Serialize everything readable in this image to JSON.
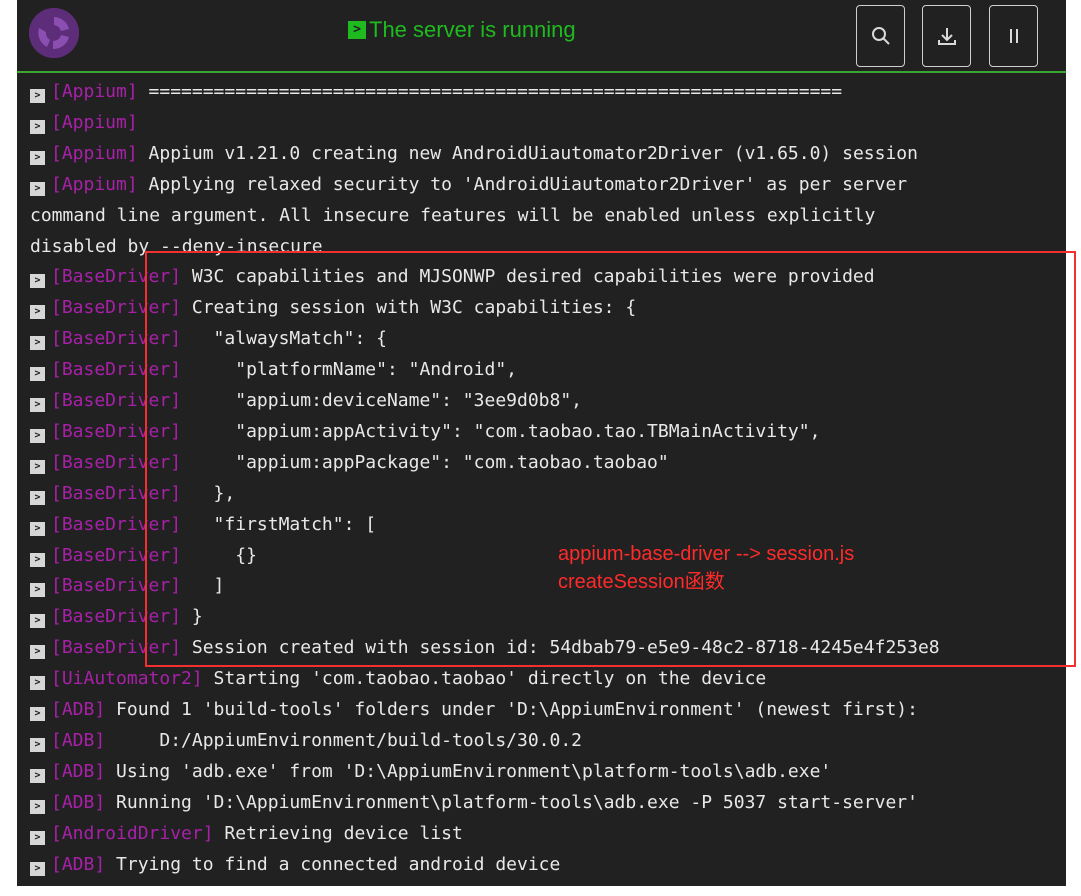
{
  "header": {
    "status_text": "The server is running",
    "buttons": [
      {
        "name": "search-button",
        "icon": "search-icon"
      },
      {
        "name": "download-logs-button",
        "icon": "download-icon"
      },
      {
        "name": "pause-button",
        "icon": "pause-icon"
      }
    ]
  },
  "log": [
    {
      "tag": "[Appium]",
      "msg": " ================================================================"
    },
    {
      "tag": "[Appium]",
      "msg": ""
    },
    {
      "tag": "[Appium]",
      "msg": " Appium v1.21.0 creating new AndroidUiautomator2Driver (v1.65.0) session"
    },
    {
      "tag": "[Appium]",
      "msg": " Applying relaxed security to 'AndroidUiautomator2Driver' as per server"
    },
    {
      "tag": "",
      "msg": "command line argument. All insecure features will be enabled unless explicitly"
    },
    {
      "tag": "",
      "msg": "disabled by --deny-insecure"
    },
    {
      "tag": "[BaseDriver]",
      "msg": " W3C capabilities and MJSONWP desired capabilities were provided"
    },
    {
      "tag": "[BaseDriver]",
      "msg": " Creating session with W3C capabilities: {"
    },
    {
      "tag": "[BaseDriver]",
      "msg": "   \"alwaysMatch\": {"
    },
    {
      "tag": "[BaseDriver]",
      "msg": "     \"platformName\": \"Android\","
    },
    {
      "tag": "[BaseDriver]",
      "msg": "     \"appium:deviceName\": \"3ee9d0b8\","
    },
    {
      "tag": "[BaseDriver]",
      "msg": "     \"appium:appActivity\": \"com.taobao.tao.TBMainActivity\","
    },
    {
      "tag": "[BaseDriver]",
      "msg": "     \"appium:appPackage\": \"com.taobao.taobao\""
    },
    {
      "tag": "[BaseDriver]",
      "msg": "   },"
    },
    {
      "tag": "[BaseDriver]",
      "msg": "   \"firstMatch\": ["
    },
    {
      "tag": "[BaseDriver]",
      "msg": "     {}"
    },
    {
      "tag": "[BaseDriver]",
      "msg": "   ]"
    },
    {
      "tag": "[BaseDriver]",
      "msg": " }"
    },
    {
      "tag": "[BaseDriver]",
      "msg": " Session created with session id: 54dbab79-e5e9-48c2-8718-4245e4f253e8"
    },
    {
      "tag": "[UiAutomator2]",
      "msg": " Starting 'com.taobao.taobao' directly on the device"
    },
    {
      "tag": "[ADB]",
      "msg": " Found 1 'build-tools' folders under 'D:\\AppiumEnvironment' (newest first):"
    },
    {
      "tag": "[ADB]",
      "msg": "     D:/AppiumEnvironment/build-tools/30.0.2"
    },
    {
      "tag": "[ADB]",
      "msg": " Using 'adb.exe' from 'D:\\AppiumEnvironment\\platform-tools\\adb.exe'"
    },
    {
      "tag": "[ADB]",
      "msg": " Running 'D:\\AppiumEnvironment\\platform-tools\\adb.exe -P 5037 start-server'"
    },
    {
      "tag": "[AndroidDriver]",
      "msg": " Retrieving device list"
    },
    {
      "tag": "[ADB]",
      "msg": " Trying to find a connected android device"
    }
  ],
  "annotation": {
    "line1": "appium-base-driver --> session.js",
    "line2": "createSession函数"
  },
  "colors": {
    "background": "#212121",
    "status_green": "#1fba1f",
    "tag_magenta": "#a820a8",
    "annotation_red": "#f23030"
  }
}
